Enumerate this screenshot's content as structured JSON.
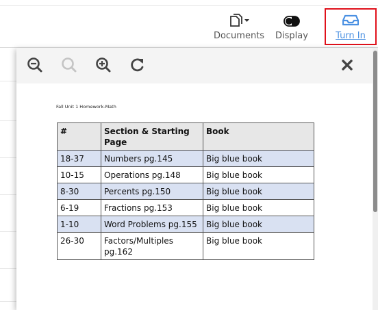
{
  "toolbar": {
    "documents": {
      "label": "Documents",
      "icon": "documents-dropdown-icon"
    },
    "display": {
      "label": "Display",
      "icon": "toggle-icon"
    },
    "turn_in": {
      "label": "Turn In",
      "icon": "inbox-tray-icon",
      "color": "#4a90e2",
      "highlight": "#e0101a"
    }
  },
  "viewer": {
    "tools": [
      "zoom-out-icon",
      "zoom-reset-icon",
      "zoom-in-icon",
      "rotate-icon"
    ],
    "close_icon": "close-icon"
  },
  "document": {
    "header": "Fall Unit 1 Homework-Math",
    "columns": [
      "#",
      "Section & Starting Page",
      "Book"
    ],
    "rows": [
      {
        "num": "18-37",
        "section": "Numbers pg.145",
        "book": "Big blue book",
        "shaded": true
      },
      {
        "num": "10-15",
        "section": "Operations pg.148",
        "book": "Big blue book",
        "shaded": false
      },
      {
        "num": "8-30",
        "section": "Percents pg.150",
        "book": "Big blue book",
        "shaded": true
      },
      {
        "num": "6-19",
        "section": "Fractions pg.153",
        "book": "Big blue book",
        "shaded": false
      },
      {
        "num": "1-10",
        "section": "Word Problems pg.155",
        "book": "Big blue book",
        "shaded": true
      },
      {
        "num": "26-30",
        "section": "Factors/Multiples pg.162",
        "book": "Big blue book",
        "shaded": false
      }
    ]
  },
  "colors": {
    "row_shade": "#d9e1f2",
    "header_shade": "#e7e7e7"
  }
}
